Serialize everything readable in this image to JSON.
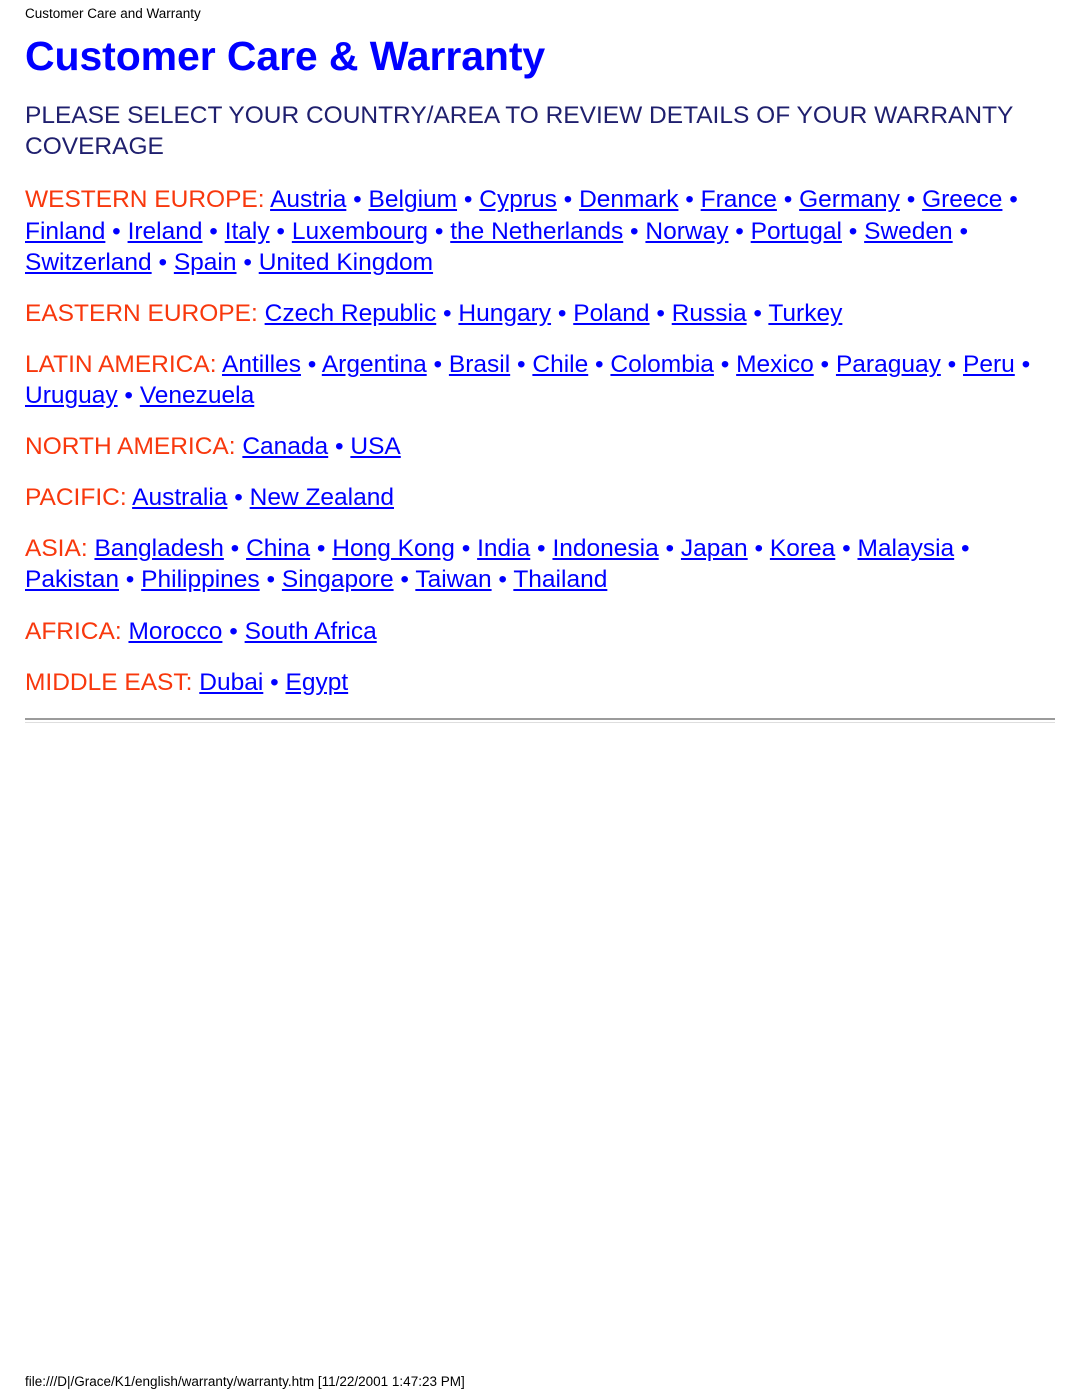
{
  "header": {
    "running_head": "Customer Care and Warranty"
  },
  "document": {
    "title": "Customer Care & Warranty",
    "subtitle": "PLEASE SELECT YOUR COUNTRY/AREA TO REVIEW DETAILS OF YOUR WARRANTY COVERAGE",
    "label_suffix": ":",
    "separator": "•"
  },
  "colors": {
    "title": "#0000FF",
    "subtitle": "#1F1F6E",
    "region_label": "#F8380D",
    "link": "#0000FF",
    "rule": "#9B9B9B",
    "background": "#FFFFFF",
    "text": "#000000"
  },
  "regions": [
    {
      "label": "WESTERN EUROPE",
      "countries": [
        "Austria",
        "Belgium",
        "Cyprus",
        "Denmark",
        "France",
        "Germany",
        "Greece",
        "Finland",
        "Ireland",
        "Italy",
        "Luxembourg",
        "the Netherlands",
        "Norway",
        "Portugal",
        "Sweden",
        "Switzerland",
        "Spain",
        "United Kingdom"
      ]
    },
    {
      "label": "EASTERN EUROPE",
      "countries": [
        "Czech Republic",
        "Hungary",
        "Poland",
        "Russia",
        "Turkey"
      ]
    },
    {
      "label": "LATIN AMERICA",
      "countries": [
        "Antilles",
        "Argentina",
        "Brasil",
        "Chile",
        "Colombia",
        "Mexico",
        "Paraguay",
        "Peru",
        "Uruguay",
        "Venezuela"
      ]
    },
    {
      "label": "NORTH AMERICA",
      "countries": [
        "Canada",
        "USA"
      ]
    },
    {
      "label": "PACIFIC",
      "countries": [
        "Australia",
        "New Zealand"
      ]
    },
    {
      "label": "ASIA",
      "countries": [
        "Bangladesh",
        "China",
        "Hong Kong",
        "India",
        "Indonesia",
        "Japan",
        "Korea",
        "Malaysia",
        "Pakistan",
        "Philippines",
        "Singapore",
        "Taiwan",
        "Thailand"
      ]
    },
    {
      "label": "AFRICA",
      "countries": [
        "Morocco",
        "South Africa"
      ]
    },
    {
      "label": "MIDDLE EAST",
      "countries": [
        "Dubai",
        "Egypt"
      ]
    }
  ],
  "footer": {
    "path_and_timestamp": "file:///D|/Grace/K1/english/warranty/warranty.htm [11/22/2001 1:47:23 PM]"
  }
}
